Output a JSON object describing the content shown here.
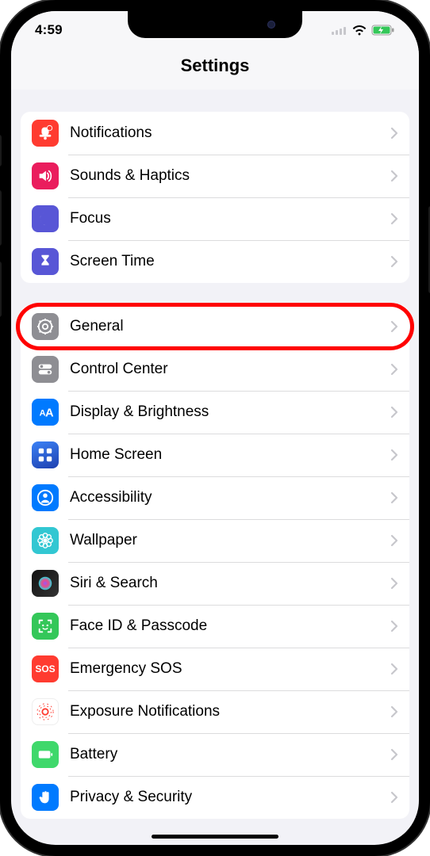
{
  "status": {
    "time": "4:59"
  },
  "header": {
    "title": "Settings"
  },
  "groups": [
    {
      "rows": [
        {
          "key": "notifications",
          "label": "Notifications",
          "icon": "bell-icon",
          "color": "ic-red",
          "highlighted": false
        },
        {
          "key": "sounds",
          "label": "Sounds & Haptics",
          "icon": "speaker-icon",
          "color": "ic-pink",
          "highlighted": false
        },
        {
          "key": "focus",
          "label": "Focus",
          "icon": "moon-icon",
          "color": "ic-indigo",
          "highlighted": false
        },
        {
          "key": "screentime",
          "label": "Screen Time",
          "icon": "hourglass-icon",
          "color": "ic-indigo",
          "highlighted": false
        }
      ]
    },
    {
      "rows": [
        {
          "key": "general",
          "label": "General",
          "icon": "gear-icon",
          "color": "ic-gray",
          "highlighted": true
        },
        {
          "key": "controlcenter",
          "label": "Control Center",
          "icon": "toggles-icon",
          "color": "ic-darkgray",
          "highlighted": false
        },
        {
          "key": "display",
          "label": "Display & Brightness",
          "icon": "text-size-icon",
          "color": "ic-blue",
          "highlighted": false
        },
        {
          "key": "homescreen",
          "label": "Home Screen",
          "icon": "grid-icon",
          "color": "ic-bluegrad",
          "highlighted": false
        },
        {
          "key": "accessibility",
          "label": "Accessibility",
          "icon": "person-icon",
          "color": "ic-blue",
          "highlighted": false
        },
        {
          "key": "wallpaper",
          "label": "Wallpaper",
          "icon": "flower-icon",
          "color": "ic-teal",
          "highlighted": false
        },
        {
          "key": "siri",
          "label": "Siri & Search",
          "icon": "siri-icon",
          "color": "ic-swirl",
          "highlighted": false
        },
        {
          "key": "faceid",
          "label": "Face ID & Passcode",
          "icon": "face-icon",
          "color": "ic-green",
          "highlighted": false
        },
        {
          "key": "sos",
          "label": "Emergency SOS",
          "icon": "sos-icon",
          "color": "ic-red",
          "highlighted": false
        },
        {
          "key": "exposure",
          "label": "Exposure Notifications",
          "icon": "exposure-icon",
          "color": "ic-white",
          "highlighted": false
        },
        {
          "key": "battery",
          "label": "Battery",
          "icon": "battery-icon",
          "color": "ic-lime",
          "highlighted": false
        },
        {
          "key": "privacy",
          "label": "Privacy & Security",
          "icon": "hand-icon",
          "color": "ic-bluehand",
          "highlighted": false
        }
      ]
    }
  ]
}
